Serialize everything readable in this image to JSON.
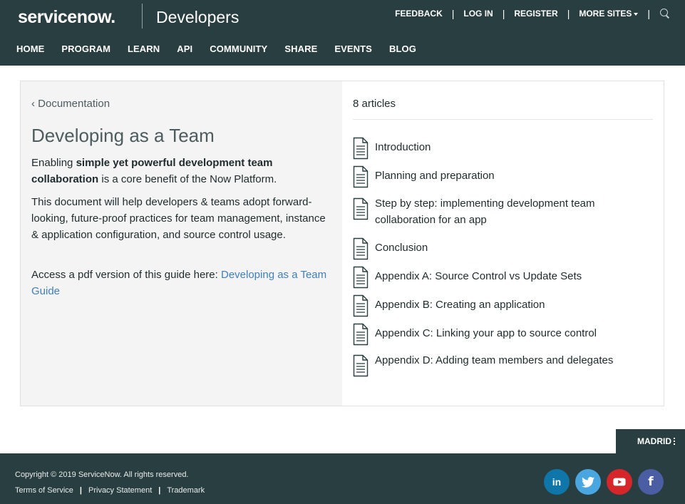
{
  "header": {
    "logo_text": "servicenow.",
    "site_name": "Developers",
    "top_links": {
      "feedback": "FEEDBACK",
      "login": "LOG IN",
      "register": "REGISTER",
      "more_sites": "MORE SITES",
      "separator": "|"
    },
    "main_nav": [
      "HOME",
      "PROGRAM",
      "LEARN",
      "API",
      "COMMUNITY",
      "SHARE",
      "EVENTS",
      "BLOG"
    ]
  },
  "left_pane": {
    "breadcrumb": "‹ Documentation",
    "title": "Developing as a Team",
    "intro_prefix": "Enabling ",
    "intro_bold": "simple yet powerful development team collaboration",
    "intro_suffix": " is a core benefit of the Now Platform.",
    "paragraph2": "This document will help developers & teams adopt forward-looking, future-proof practices for team management, instance & application configuration, and source control usage.",
    "pdf_prefix": "Access a pdf version of this guide here: ",
    "pdf_link": "Developing as a Team Guide"
  },
  "right_pane": {
    "article_count": "8 articles",
    "articles": [
      "Introduction",
      "Planning and preparation",
      "Step by step: implementing development team collaboration for an app",
      "Conclusion",
      "Appendix A: Source Control vs Update Sets",
      "Appendix B: Creating an application",
      "Appendix C: Linking your app to source control",
      "Appendix D: Adding team members and delegates"
    ]
  },
  "release_tab": {
    "label": "MADRID"
  },
  "footer": {
    "copyright": "Copyright © 2019 ServiceNow. All rights reserved.",
    "links": [
      "Terms of Service",
      "Privacy Statement",
      "Trademark"
    ],
    "separator": "|",
    "social": {
      "linkedin": "in",
      "facebook": "f",
      "icons": [
        "linkedin-icon",
        "twitter-icon",
        "youtube-icon",
        "facebook-icon"
      ]
    }
  },
  "colors": {
    "header_bg": "#293e40",
    "left_pane_bg": "#f4f4f4",
    "link": "#3f7fbf",
    "linkedin": "#0e76a8",
    "twitter": "#4aa6e0",
    "youtube": "#d6262a",
    "facebook": "#4b5da3"
  }
}
